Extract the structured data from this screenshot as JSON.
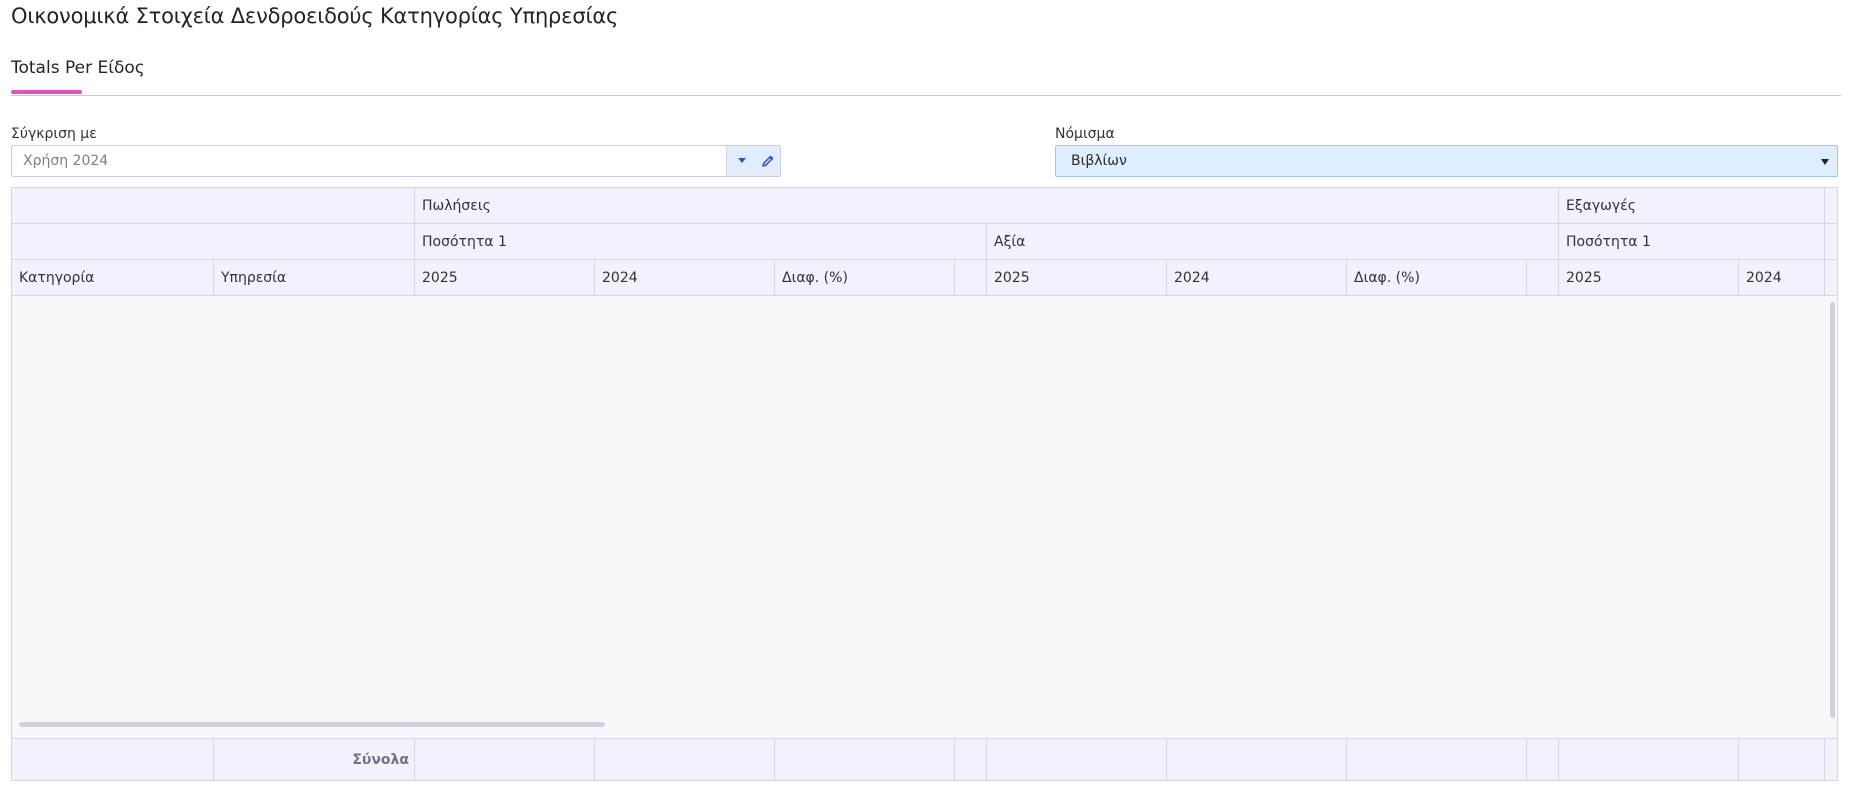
{
  "page": {
    "title": "Οικονομικά Στοιχεία Δενδροειδούς Κατηγορίας Υπηρεσίας"
  },
  "tabs": [
    {
      "label": "Totals Per Είδος",
      "active": true
    }
  ],
  "filters": {
    "compare": {
      "label": "Σύγκριση με",
      "value": "Χρήση 2024",
      "dropdown_icon": "caret-down-icon",
      "edit_icon": "pencil-icon"
    },
    "currency": {
      "label": "Νόμισμα",
      "value": "Βιβλίων",
      "dropdown_icon": "caret-down-icon"
    }
  },
  "grid": {
    "group_headers": {
      "sales": "Πωλήσεις",
      "exports": "Εξαγωγές"
    },
    "sub_headers": {
      "sales_qty": "Ποσότητα 1",
      "sales_value": "Αξία",
      "exports_qty": "Ποσότητα 1"
    },
    "columns": {
      "category": "Κατηγορία",
      "service": "Υπηρεσία",
      "sales_qty_2025": "2025",
      "sales_qty_2024": "2024",
      "sales_qty_diff": "Διαφ. (%)",
      "sales_val_2025": "2025",
      "sales_val_2024": "2024",
      "sales_val_diff": "Διαφ. (%)",
      "exports_qty_2025": "2025",
      "exports_qty_2024": "2024"
    },
    "rows": [],
    "footer": {
      "totals_label": "Σύνολα"
    }
  },
  "colors": {
    "accent": "#e052c4",
    "header_bg": "#f1f2fb",
    "selected_field_bg": "#dfeefe"
  }
}
